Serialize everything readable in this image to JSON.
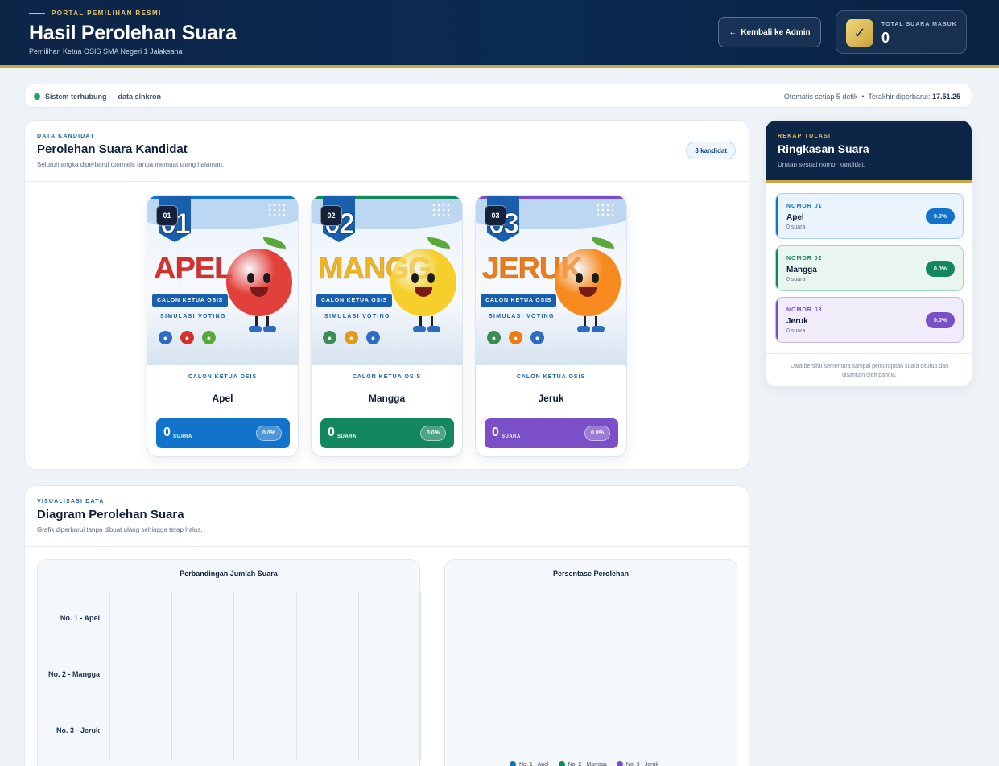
{
  "header": {
    "eyebrow": "PORTAL PEMILIHAN RESMI",
    "title": "Hasil Perolehan Suara",
    "subtitle": "Pemilihan Ketua OSIS SMA Negeri 1 Jalaksana",
    "back_button": "Kembali ke Admin",
    "back_arrow": "←",
    "total_label": "TOTAL SUARA MASUK",
    "total_value": "0",
    "check_glyph": "✓"
  },
  "status": {
    "left": "Sistem terhubung — data sinkron",
    "auto": "Otomatis setiap 5 detik",
    "separator": "•",
    "updated_label": "Terakhir diperbarui:",
    "updated_time": "17.51.25"
  },
  "candidates_panel": {
    "eyebrow": "DATA KANDIDAT",
    "title": "Perolehan Suara Kandidat",
    "subtitle": "Seluruh angka diperbarui otomatis tanpa memuat ulang halaman.",
    "count_badge": "3 kandidat"
  },
  "candidates": [
    {
      "number": "01",
      "poster_number": "01",
      "poster_name": "APEL",
      "poster_banner": "CALON KETUA OSIS",
      "poster_tag": "SIMULASI VOTING",
      "role": "CALON KETUA OSIS",
      "name": "Apel",
      "votes": "0",
      "votes_unit": "SUARA",
      "percent": "0.0%",
      "color": "#1273cc",
      "name_color": "#d8312c",
      "fruit_color": "#e2413b",
      "strip_color": "#1273cc"
    },
    {
      "number": "02",
      "poster_number": "02",
      "poster_name": "MANGGA",
      "poster_banner": "CALON KETUA OSIS",
      "poster_tag": "SIMULASI VOTING",
      "role": "CALON KETUA OSIS",
      "name": "Mangga",
      "votes": "0",
      "votes_unit": "SUARA",
      "percent": "0.0%",
      "color": "#13875e",
      "name_color": "#f2b51d",
      "fruit_color": "#f6cf2a",
      "strip_color": "#13875e"
    },
    {
      "number": "03",
      "poster_number": "03",
      "poster_name": "JERUK",
      "poster_banner": "CALON KETUA OSIS",
      "poster_tag": "SIMULASI VOTING",
      "role": "CALON KETUA OSIS",
      "name": "Jeruk",
      "votes": "0",
      "votes_unit": "SUARA",
      "percent": "0.0%",
      "color": "#7a4fc7",
      "name_color": "#f07a14",
      "fruit_color": "#f68a1e",
      "strip_color": "#7a4fc7"
    }
  ],
  "summary": {
    "eyebrow": "REKAPITULASI",
    "title": "Ringkasan Suara",
    "subtitle": "Urutan sesuai nomor kandidat.",
    "items": [
      {
        "label": "NOMOR 01",
        "name": "Apel",
        "votes": "0 suara",
        "percent": "0.0%",
        "color": "#1273cc",
        "bg": "#eaf4fd",
        "border": "#a9cdf0"
      },
      {
        "label": "NOMOR 02",
        "name": "Mangga",
        "votes": "0 suara",
        "percent": "0.0%",
        "color": "#13875e",
        "bg": "#e9f5ef",
        "border": "#a6d6bf"
      },
      {
        "label": "NOMOR 03",
        "name": "Jeruk",
        "votes": "0 suara",
        "percent": "0.0%",
        "color": "#7a4fc7",
        "bg": "#f1ecfa",
        "border": "#c9b6ea"
      }
    ],
    "footer": "Data bersifat sementara sampai pemungutan suara ditutup dan disahkan oleh panitia."
  },
  "chart_panel": {
    "eyebrow": "VISUALISASI DATA",
    "title": "Diagram Perolehan Suara",
    "subtitle": "Grafik diperbarui tanpa dibuat ulang sehingga tetap halus."
  },
  "chart_data": [
    {
      "type": "bar",
      "orientation": "horizontal",
      "title": "Perbandingan Jumlah Suara",
      "categories": [
        "No. 1 - Apel",
        "No. 2 - Mangga",
        "No. 3 - Jeruk"
      ],
      "values": [
        0,
        0,
        0
      ],
      "colors": [
        "#1273cc",
        "#13875e",
        "#7a4fc7"
      ],
      "grid": true
    },
    {
      "type": "pie",
      "title": "Persentase Perolehan",
      "categories": [
        "No. 1 - Apel",
        "No. 2 - Mangga",
        "No. 3 - Jeruk"
      ],
      "values": [
        0,
        0,
        0
      ],
      "colors": [
        "#1273cc",
        "#13875e",
        "#7a4fc7"
      ],
      "legend": "bottom"
    }
  ]
}
